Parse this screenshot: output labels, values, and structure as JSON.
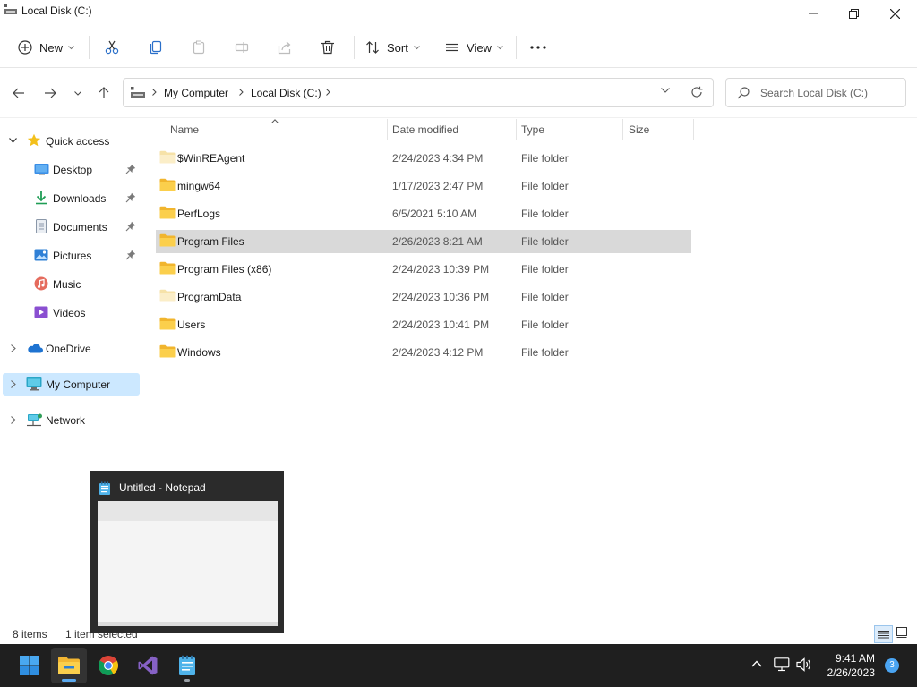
{
  "window": {
    "title": "Local Disk (C:)"
  },
  "toolbar": {
    "new_label": "New",
    "sort_label": "Sort",
    "view_label": "View"
  },
  "address": {
    "crumbs": [
      "My Computer",
      "Local Disk (C:)"
    ]
  },
  "search": {
    "placeholder": "Search Local Disk (C:)"
  },
  "nav": {
    "quick_access": "Quick access",
    "items": [
      {
        "label": "Desktop",
        "icon": "desktop-icon",
        "pinned": true
      },
      {
        "label": "Downloads",
        "icon": "downloads-icon",
        "pinned": true
      },
      {
        "label": "Documents",
        "icon": "documents-icon",
        "pinned": true
      },
      {
        "label": "Pictures",
        "icon": "pictures-icon",
        "pinned": true
      },
      {
        "label": "Music",
        "icon": "music-icon",
        "pinned": false
      },
      {
        "label": "Videos",
        "icon": "videos-icon",
        "pinned": false
      }
    ],
    "onedrive": "OneDrive",
    "my_computer": "My Computer",
    "network": "Network"
  },
  "columns": {
    "name": "Name",
    "date": "Date modified",
    "type": "Type",
    "size": "Size"
  },
  "files": [
    {
      "name": "$WinREAgent",
      "date": "2/24/2023 4:34 PM",
      "type": "File folder",
      "faded": true
    },
    {
      "name": "mingw64",
      "date": "1/17/2023 2:47 PM",
      "type": "File folder"
    },
    {
      "name": "PerfLogs",
      "date": "6/5/2021 5:10 AM",
      "type": "File folder"
    },
    {
      "name": "Program Files",
      "date": "2/26/2023 8:21 AM",
      "type": "File folder",
      "selected": true
    },
    {
      "name": "Program Files (x86)",
      "date": "2/24/2023 10:39 PM",
      "type": "File folder"
    },
    {
      "name": "ProgramData",
      "date": "2/24/2023 10:36 PM",
      "type": "File folder",
      "faded": true
    },
    {
      "name": "Users",
      "date": "2/24/2023 10:41 PM",
      "type": "File folder"
    },
    {
      "name": "Windows",
      "date": "2/24/2023 4:12 PM",
      "type": "File folder"
    }
  ],
  "status": {
    "count": "8 items",
    "selection": "1 item selected"
  },
  "preview": {
    "title": "Untitled - Notepad"
  },
  "taskbar": {
    "apps": [
      "start-icon",
      "file-explorer-icon",
      "chrome-icon",
      "visual-studio-icon",
      "notepad-icon"
    ],
    "time": "9:41 AM",
    "date": "2/26/2023",
    "notifications": "3"
  },
  "colors": {
    "accent": "#0067c0",
    "selection": "#cce8ff",
    "folder": "#f8c74a",
    "taskbar": "#1f1f1f"
  }
}
